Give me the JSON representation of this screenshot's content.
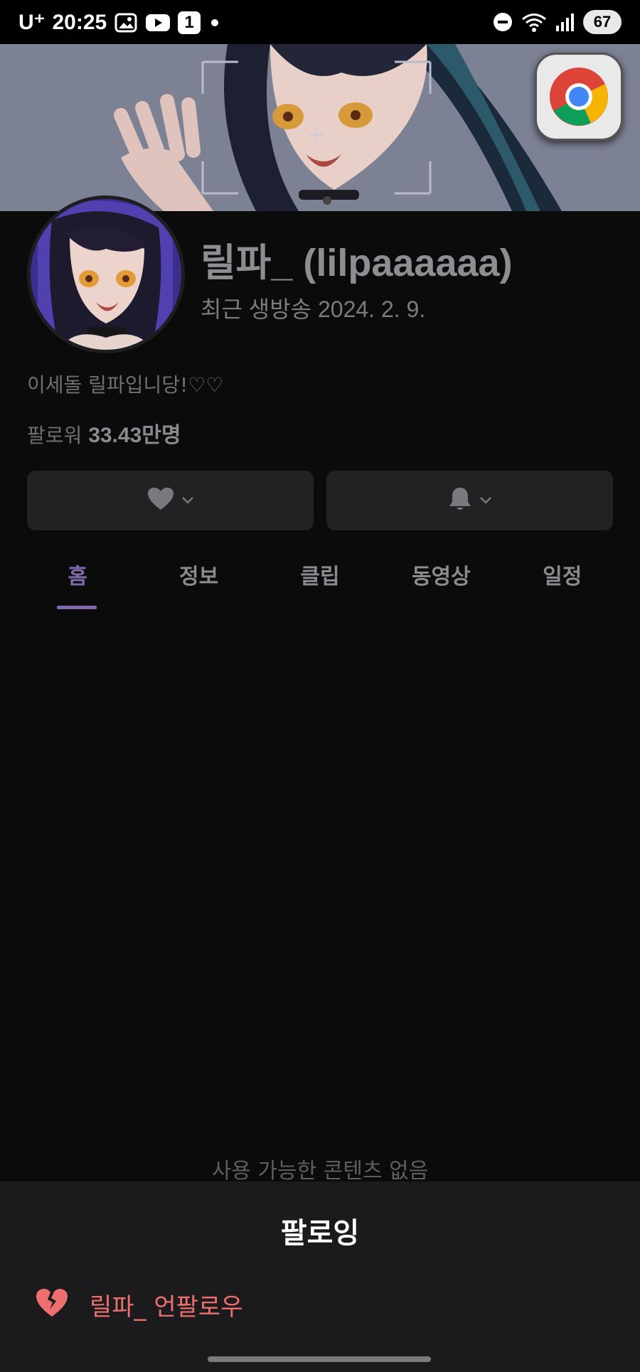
{
  "status_bar": {
    "carrier": "U⁺",
    "time": "20:25",
    "notification_count": "1",
    "battery": "67",
    "icons": [
      "gallery-icon",
      "youtube-icon",
      "badge-icon",
      "dot-icon",
      "dnd-icon",
      "wifi-icon",
      "signal-icon",
      "battery-icon"
    ]
  },
  "floating_app": {
    "name": "chrome-bubble-icon"
  },
  "profile": {
    "channel_name": "릴파_ (lilpaaaaaa)",
    "last_live": "최근 생방송 2024. 2. 9.",
    "bio": "이세돌 릴파입니당!♡♡",
    "followers_label": "팔로워",
    "followers_value": "33.43만명"
  },
  "actions": {
    "follow_icon": "heart-icon",
    "notify_icon": "bell-icon"
  },
  "tabs": [
    {
      "label": "홈",
      "active": true
    },
    {
      "label": "정보",
      "active": false
    },
    {
      "label": "클립",
      "active": false
    },
    {
      "label": "동영상",
      "active": false
    },
    {
      "label": "일정",
      "active": false
    }
  ],
  "empty_state": "사용 가능한 콘텐츠 없음",
  "sheet": {
    "title": "팔로잉",
    "unfollow_label": "릴파_ 언팔로우",
    "unfollow_icon": "broken-heart-icon"
  },
  "colors": {
    "accent": "#7f6bab",
    "danger": "#ee6f6f",
    "background": "#0b0b0c",
    "sheet": "#1b1b1d"
  }
}
